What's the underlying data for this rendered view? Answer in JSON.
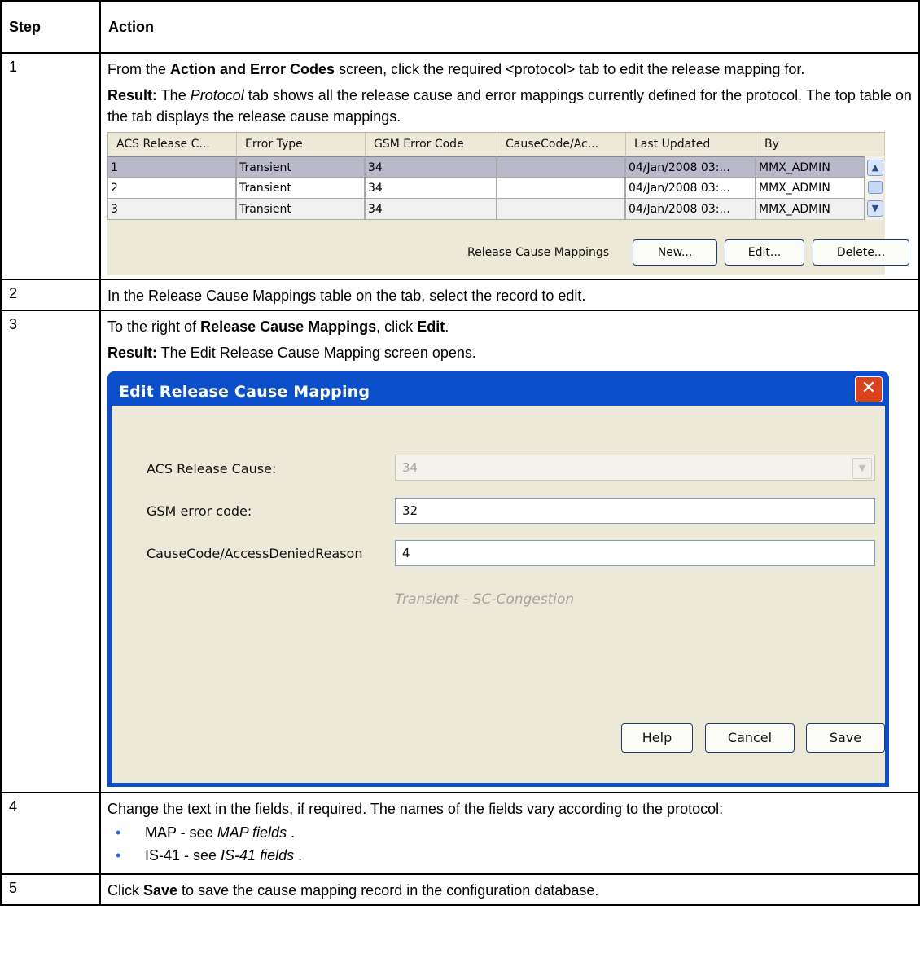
{
  "headers": {
    "step": "Step",
    "action": "Action"
  },
  "step1": {
    "num": "1",
    "line1_pre": "From the ",
    "line1_bold": "Action and Error Codes",
    "line1_post": " screen, click the required <protocol> tab to edit the release mapping for.",
    "result_label": "Result:",
    "result_pre": " The ",
    "result_ital": "Protocol",
    "result_post": " tab shows all the release cause and error mappings currently defined for the protocol. The top table on the tab displays the release cause mappings.",
    "mini_table": {
      "columns": [
        "ACS Release C...",
        "Error Type",
        "GSM Error Code",
        "CauseCode/Ac...",
        "Last Updated",
        "By"
      ],
      "rows": [
        [
          "1",
          "Transient",
          "34",
          "",
          "04/Jan/2008 03:...",
          "MMX_ADMIN"
        ],
        [
          "2",
          "Transient",
          "34",
          "",
          "04/Jan/2008 03:...",
          "MMX_ADMIN"
        ],
        [
          "3",
          "Transient",
          "34",
          "",
          "04/Jan/2008 03:...",
          "MMX_ADMIN"
        ]
      ],
      "section_label": "Release Cause Mappings",
      "new_label": "New...",
      "edit_label": "Edit...",
      "delete_label": "Delete..."
    }
  },
  "step2": {
    "num": "2",
    "text": "In the Release Cause Mappings table on the tab, select the record to edit."
  },
  "step3": {
    "num": "3",
    "pre": "To the right of ",
    "bold1": "Release Cause Mappings",
    "mid": ", click ",
    "bold2": "Edit",
    "post": ".",
    "result_label": "Result:",
    "result_text": " The Edit Release Cause Mapping screen opens.",
    "dialog": {
      "title": "Edit Release Cause Mapping",
      "acs_label": "ACS Release Cause:",
      "acs_value": "34",
      "gsm_label": "GSM error code:",
      "gsm_value": "32",
      "cause_label": "CauseCode/AccessDeniedReason",
      "cause_value": "4",
      "hint": "Transient - SC-Congestion",
      "help_label": "Help",
      "cancel_label": "Cancel",
      "save_label": "Save"
    }
  },
  "step4": {
    "num": "4",
    "text": "Change the text in the fields, if required. The names of the fields vary according to the protocol:",
    "bullets": [
      {
        "pre": "MAP - see ",
        "ital": "MAP fields",
        "post": " ."
      },
      {
        "pre": "IS-41 - see ",
        "ital": "IS-41 fields",
        "post": " ."
      }
    ]
  },
  "step5": {
    "num": "5",
    "pre": "Click ",
    "bold": "Save",
    "post": " to save the cause mapping record in the configuration database."
  }
}
